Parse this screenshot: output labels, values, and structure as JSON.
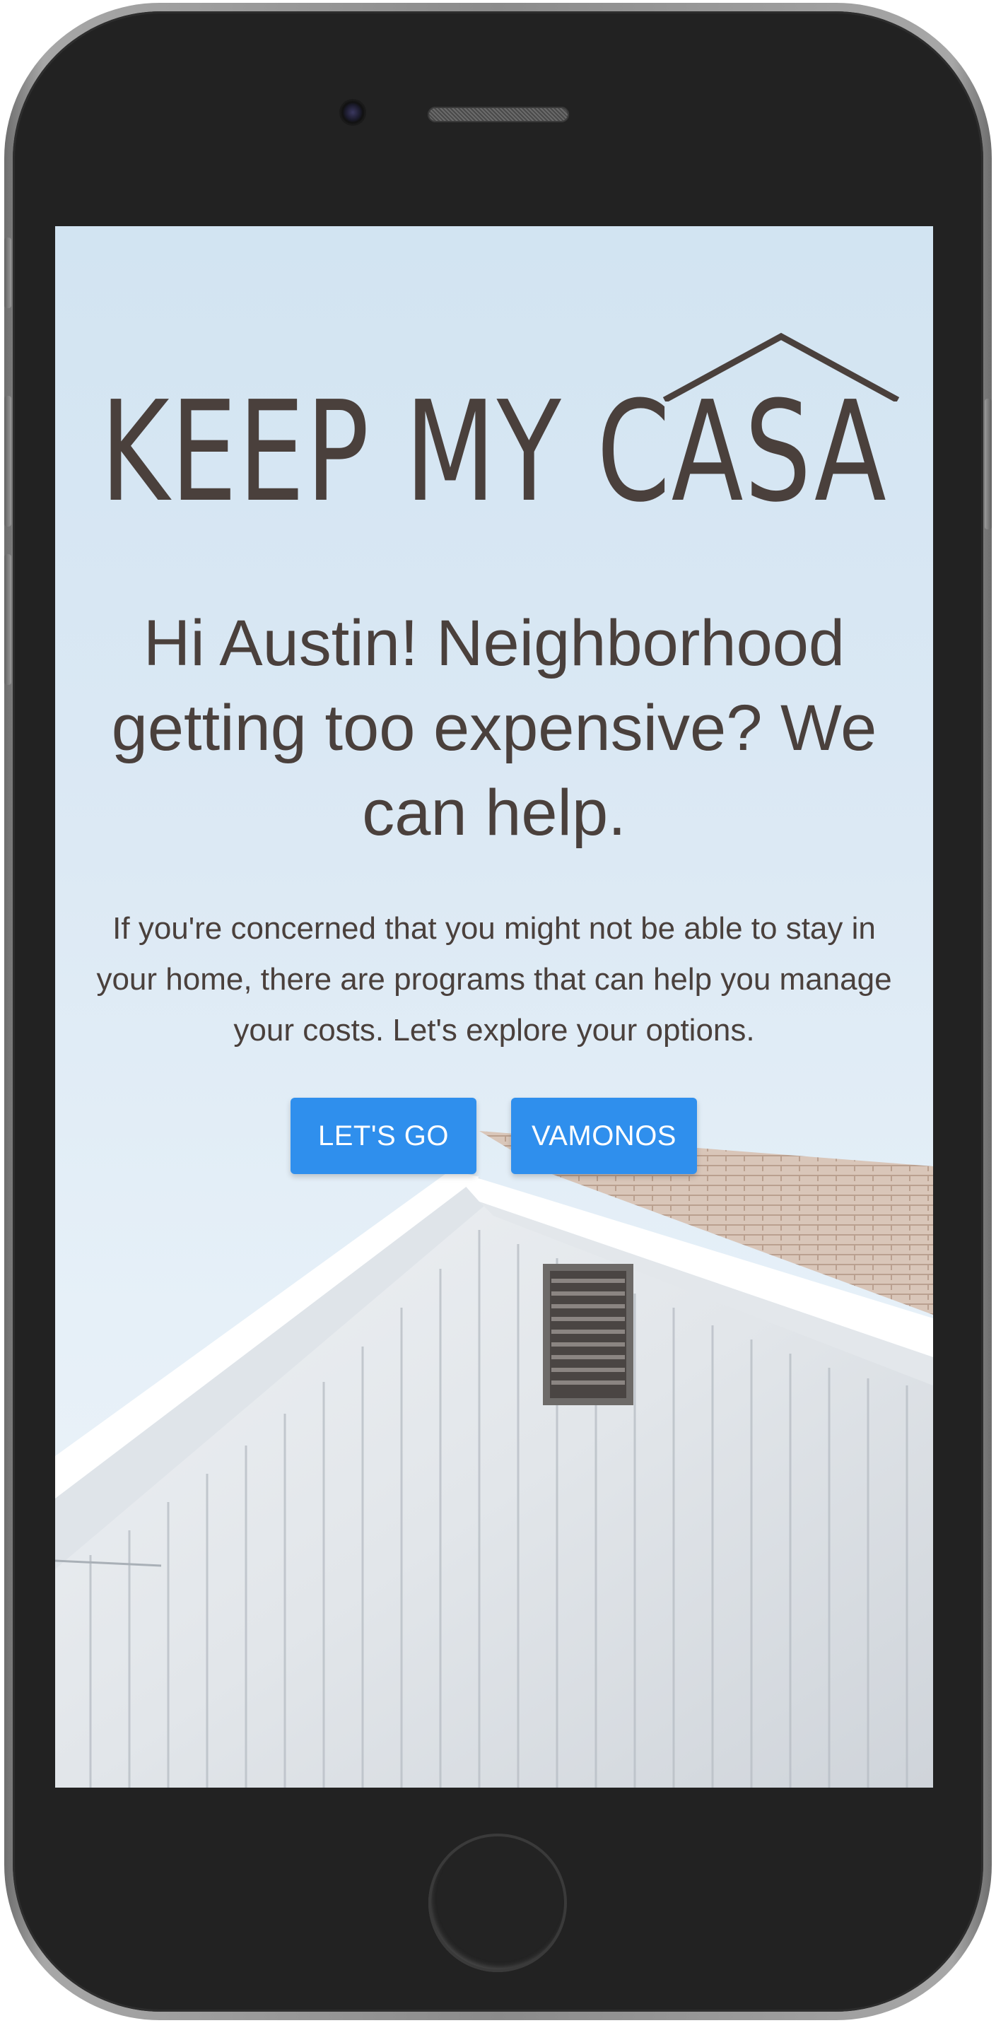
{
  "device": {
    "type": "smartphone"
  },
  "app": {
    "logo_text": "KEEP MY CASA",
    "headline": "Hi Austin! Neighborhood getting too expensive? We can help.",
    "intro": "If you're concerned that you might not be able to stay in your home, there are programs that can help you manage your costs. Let's explore your options.",
    "buttons": {
      "english_label": "LET'S GO",
      "spanish_label": "VAMONOS"
    }
  },
  "colors": {
    "accent": "#2f8fed",
    "text": "#4a403c",
    "sky": "#d2e4f2"
  },
  "icons": {
    "logo_roof": "roof-outline-icon"
  }
}
